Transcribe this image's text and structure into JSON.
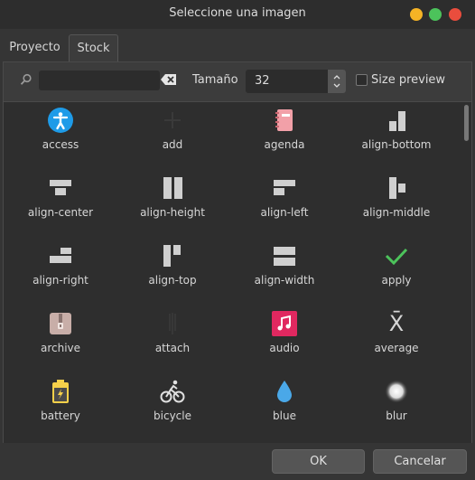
{
  "window": {
    "title": "Seleccione una imagen",
    "controls": {
      "minimize_color": "#f5b325",
      "maximize_color": "#4cc35b",
      "close_color": "#ea4d3d"
    }
  },
  "tabs": [
    {
      "label": "Proyecto",
      "active": false
    },
    {
      "label": "Stock",
      "active": true
    }
  ],
  "toolbar": {
    "search_value": "",
    "size_label": "Tamaño",
    "size_value": "32",
    "size_preview_label": "Size preview",
    "size_preview_checked": false
  },
  "icons": [
    {
      "label": "access",
      "icon": "access-icon"
    },
    {
      "label": "add",
      "icon": "add-icon"
    },
    {
      "label": "agenda",
      "icon": "agenda-icon"
    },
    {
      "label": "align-bottom",
      "icon": "align-bottom-icon"
    },
    {
      "label": "align-center",
      "icon": "align-center-icon"
    },
    {
      "label": "align-height",
      "icon": "align-height-icon"
    },
    {
      "label": "align-left",
      "icon": "align-left-icon"
    },
    {
      "label": "align-middle",
      "icon": "align-middle-icon"
    },
    {
      "label": "align-right",
      "icon": "align-right-icon"
    },
    {
      "label": "align-top",
      "icon": "align-top-icon"
    },
    {
      "label": "align-width",
      "icon": "align-width-icon"
    },
    {
      "label": "apply",
      "icon": "apply-icon"
    },
    {
      "label": "archive",
      "icon": "archive-icon"
    },
    {
      "label": "attach",
      "icon": "attach-icon"
    },
    {
      "label": "audio",
      "icon": "audio-icon"
    },
    {
      "label": "average",
      "icon": "average-icon"
    },
    {
      "label": "battery",
      "icon": "battery-icon"
    },
    {
      "label": "bicycle",
      "icon": "bicycle-icon"
    },
    {
      "label": "blue",
      "icon": "blue-icon"
    },
    {
      "label": "blur",
      "icon": "blur-icon"
    }
  ],
  "average_glyph": "X̄",
  "buttons": {
    "ok": "OK",
    "cancel": "Cancelar"
  },
  "colors": {
    "accent_blue": "#1e9be8",
    "apply_green": "#4cc35b",
    "audio_pink": "#e02860"
  }
}
